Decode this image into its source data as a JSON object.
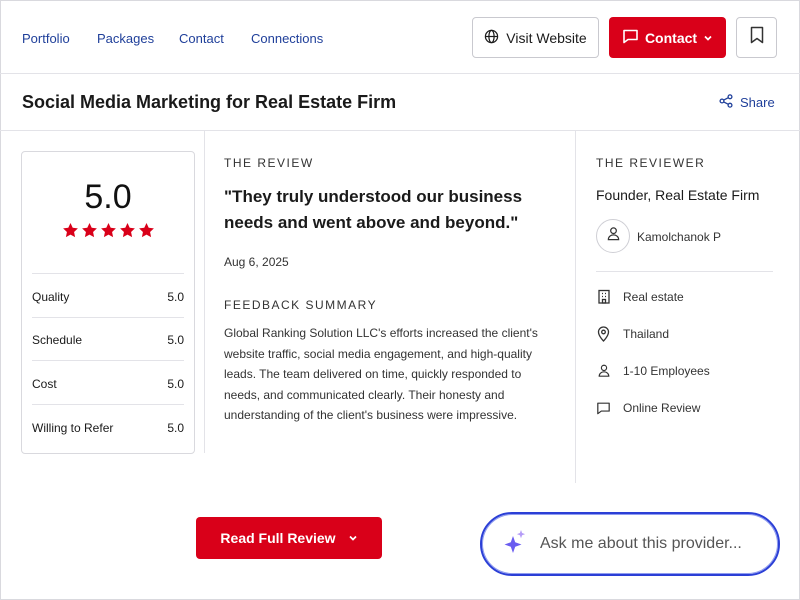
{
  "nav": {
    "links": [
      "Portfolio",
      "Packages",
      "Contact",
      "Connections"
    ],
    "visit_label": "Visit Website",
    "contact_label": "Contact"
  },
  "title": "Social Media Marketing for Real Estate Firm",
  "share_label": "Share",
  "ratings": {
    "overall": "5.0",
    "stars": 5,
    "rows": [
      {
        "label": "Quality",
        "value": "5.0"
      },
      {
        "label": "Schedule",
        "value": "5.0"
      },
      {
        "label": "Cost",
        "value": "5.0"
      },
      {
        "label": "Willing to Refer",
        "value": "5.0"
      }
    ]
  },
  "review": {
    "heading": "THE REVIEW",
    "quote": "\"They truly understood our business needs and went above and beyond.\"",
    "date": "Aug 6, 2025",
    "summary_heading": "FEEDBACK SUMMARY",
    "summary": "Global Ranking Solution LLC's efforts increased the client's website traffic, social media engagement, and high-quality leads. The team delivered on time, quickly responded to needs, and communicated clearly. Their honesty and understanding of the client's business were impressive."
  },
  "reviewer": {
    "heading": "THE REVIEWER",
    "role": "Founder, Real Estate Firm",
    "name": "Kamolchanok P",
    "details": [
      {
        "icon": "building-icon",
        "text": "Real estate"
      },
      {
        "icon": "location-pin-icon",
        "text": "Thailand"
      },
      {
        "icon": "person-icon",
        "text": "1-10 Employees"
      },
      {
        "icon": "chat-bubble-icon",
        "text": "Online Review"
      }
    ]
  },
  "read_full_label": "Read Full Review",
  "ask_placeholder": "Ask me about this provider...",
  "colors": {
    "brand_red": "#d90019",
    "link_blue": "#1f3f9a",
    "ai_border": "#2b3fd6"
  }
}
